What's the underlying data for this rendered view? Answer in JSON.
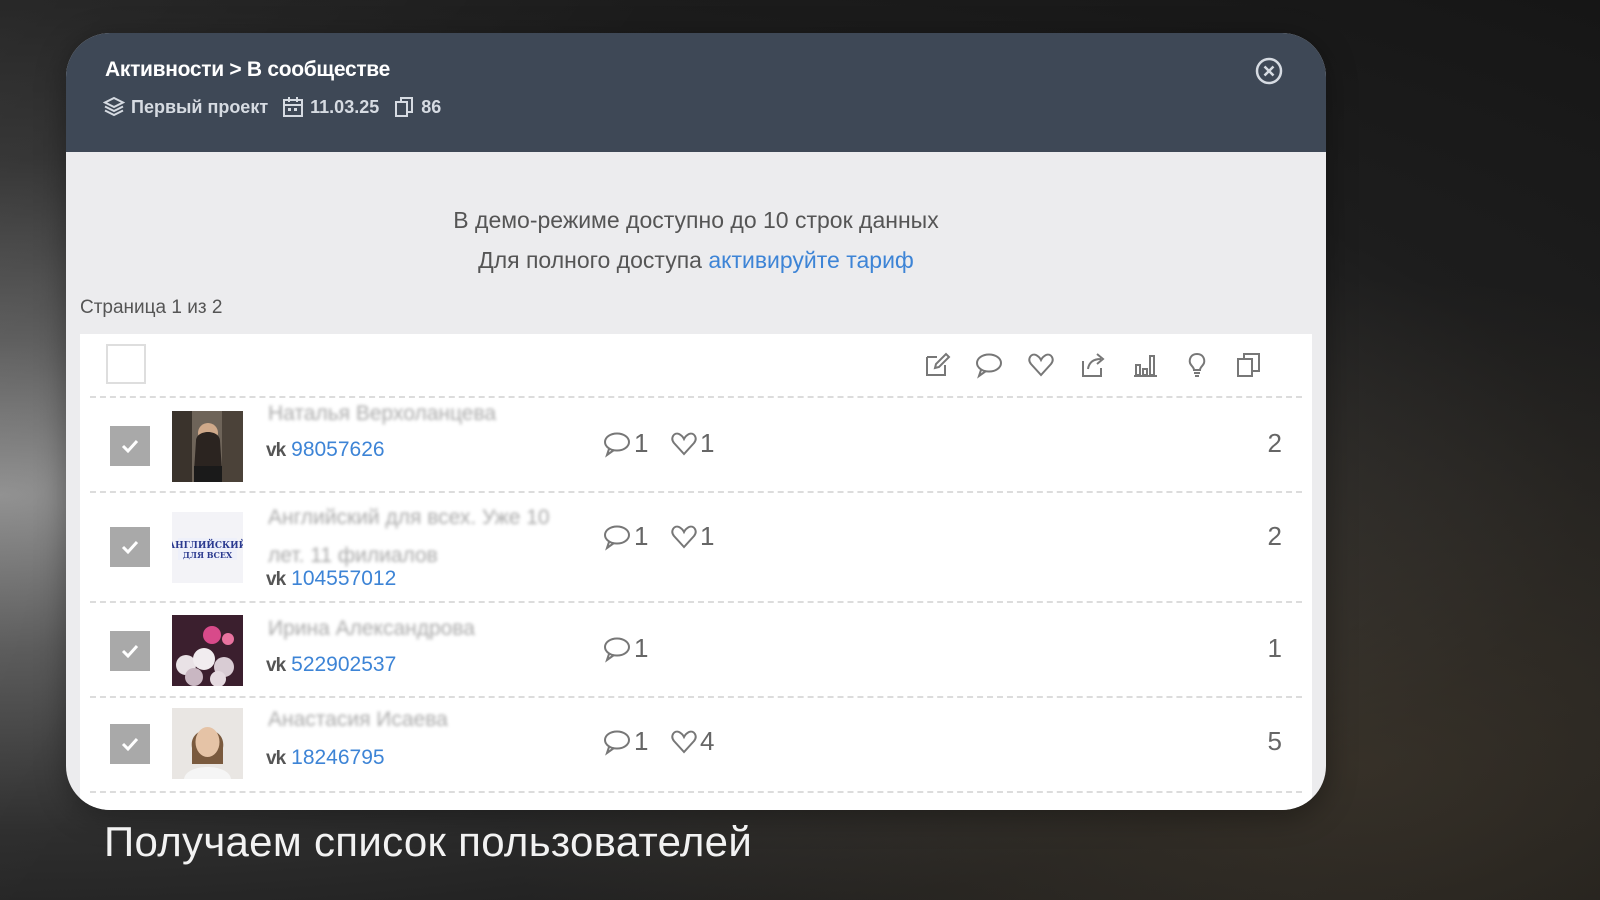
{
  "header": {
    "title": "Активности > В сообществе",
    "project": "Первый проект",
    "date": "11.03.25",
    "count": "86"
  },
  "demo": {
    "line1": "В демо-режиме доступно до 10 строк данных",
    "line2_prefix": "Для полного доступа ",
    "line2_link": "активируйте тариф"
  },
  "pagination": {
    "label": "Страница 1 из 2"
  },
  "toolbar": {
    "icons": [
      "edit-icon",
      "comment-icon",
      "heart-icon",
      "share-icon",
      "bar-chart-icon",
      "lightbulb-icon",
      "copy-icon"
    ]
  },
  "rows": [
    {
      "name": "Наталья Верхоланцева",
      "network": "vk",
      "id": "98057626",
      "comments": "1",
      "likes": "1",
      "total": "2",
      "checked": true
    },
    {
      "name": "Английский для всех. Уже 10 лет. 11 филиалов",
      "network": "vk",
      "id": "104557012",
      "comments": "1",
      "likes": "1",
      "total": "2",
      "checked": true
    },
    {
      "name": "Ирина Александрова",
      "network": "vk",
      "id": "522902537",
      "comments": "1",
      "likes": "",
      "total": "1",
      "checked": true
    },
    {
      "name": "Анастасия Исаева",
      "network": "vk",
      "id": "18246795",
      "comments": "1",
      "likes": "4",
      "total": "5",
      "checked": true
    }
  ],
  "caption": "Получаем список пользователей",
  "colors": {
    "header_bg": "#3e4856",
    "link": "#3d84d6",
    "card_bg": "#ececee"
  }
}
